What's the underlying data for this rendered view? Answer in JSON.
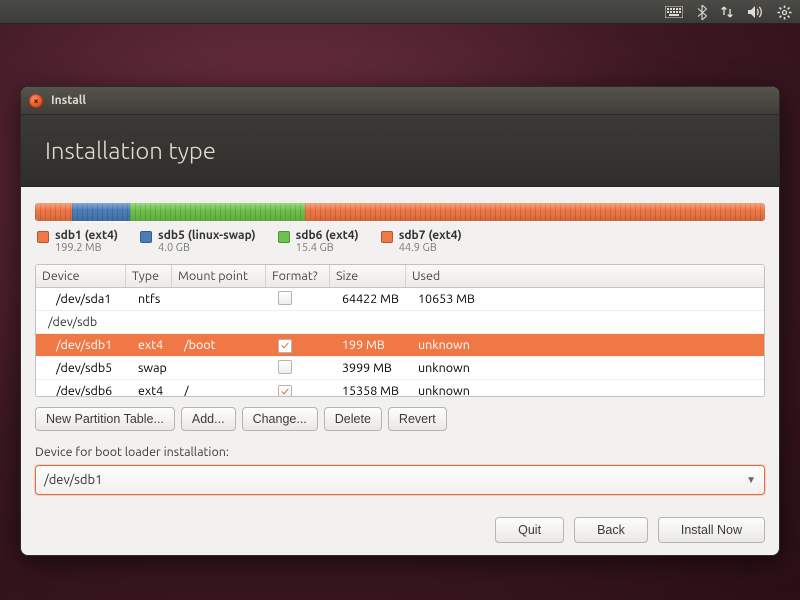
{
  "colors": {
    "orange": "#f07746",
    "blue": "#4a7db8",
    "green": "#6cc24a"
  },
  "window": {
    "title": "Install",
    "heading": "Installation type"
  },
  "partitions_bar": [
    {
      "color": "orange",
      "label": "sdb1 (ext4)",
      "sub": "199.2 MB",
      "fraction": 0.05
    },
    {
      "color": "blue",
      "label": "sdb5 (linux-swap)",
      "sub": "4.0 GB",
      "fraction": 0.08
    },
    {
      "color": "green",
      "label": "sdb6 (ext4)",
      "sub": "15.4 GB",
      "fraction": 0.24
    },
    {
      "color": "orange",
      "label": "sdb7 (ext4)",
      "sub": "44.9 GB",
      "fraction": 0.63
    }
  ],
  "table": {
    "columns": [
      "Device",
      "Type",
      "Mount point",
      "Format?",
      "Size",
      "Used"
    ],
    "rows": [
      {
        "device": "/dev/sda1",
        "type": "ntfs",
        "mount": "",
        "format": false,
        "size": "64422 MB",
        "used": "10653 MB",
        "indent": true,
        "selected": false,
        "disk": false
      },
      {
        "device": "/dev/sdb",
        "type": "",
        "mount": "",
        "format": null,
        "size": "",
        "used": "",
        "indent": false,
        "selected": false,
        "disk": true
      },
      {
        "device": "/dev/sdb1",
        "type": "ext4",
        "mount": "/boot",
        "format": true,
        "size": "199 MB",
        "used": "unknown",
        "indent": true,
        "selected": true,
        "disk": false
      },
      {
        "device": "/dev/sdb5",
        "type": "swap",
        "mount": "",
        "format": false,
        "size": "3999 MB",
        "used": "unknown",
        "indent": true,
        "selected": false,
        "disk": false
      },
      {
        "device": "/dev/sdb6",
        "type": "ext4",
        "mount": "/",
        "format": true,
        "size": "15358 MB",
        "used": "unknown",
        "indent": true,
        "selected": false,
        "disk": false
      }
    ]
  },
  "buttons": {
    "new_table": "New Partition Table...",
    "add": "Add...",
    "change": "Change...",
    "delete": "Delete",
    "revert": "Revert"
  },
  "bootloader": {
    "label": "Device for boot loader installation:",
    "value": "/dev/sdb1"
  },
  "footer": {
    "quit": "Quit",
    "back": "Back",
    "install": "Install Now"
  }
}
